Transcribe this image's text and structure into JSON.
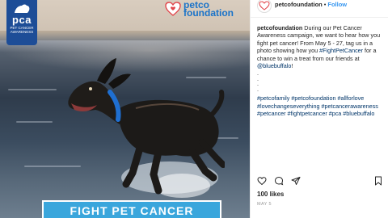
{
  "photo": {
    "badge": {
      "acronym": "pca",
      "subtitle": "PET CANCER AWARENESS"
    },
    "brand": {
      "name": "petco foundation",
      "line1": "petco",
      "line2": "foundation"
    },
    "banner": {
      "text": "FIGHT PET CANCER"
    }
  },
  "post": {
    "header": {
      "username": "petcofoundation",
      "separator": "•",
      "follow_label": "Follow"
    },
    "caption": {
      "username": "petcofoundation",
      "text_1": " During our Pet Cancer Awareness campaign, we want to hear how you fight pet cancer! From May 5 - 27, tag us in a photo showing how you ",
      "hashtag_1": "#FightPetCancer",
      "text_2": " for a chance to win a treat from our friends at ",
      "mention": "@bluebuffalo",
      "text_3": "!",
      "dots": [
        ".",
        ".",
        ".",
        "."
      ],
      "hashtags": "#petcofamily #petcofoundation #allforlove #lovechangeseverything #petcancerawareness #petcancer #fightpetcancer #pca #bluebuffalo"
    },
    "actions": [
      "heart-icon",
      "comment-icon",
      "share-icon",
      "bookmark-icon"
    ],
    "likes": "100 likes",
    "date": "MAY 5"
  },
  "colors": {
    "brand_blue": "#1a73c9",
    "banner_blue": "#3aa6dc",
    "badge_blue": "#1d4d97",
    "link": "#003569",
    "follow": "#3897f0"
  }
}
